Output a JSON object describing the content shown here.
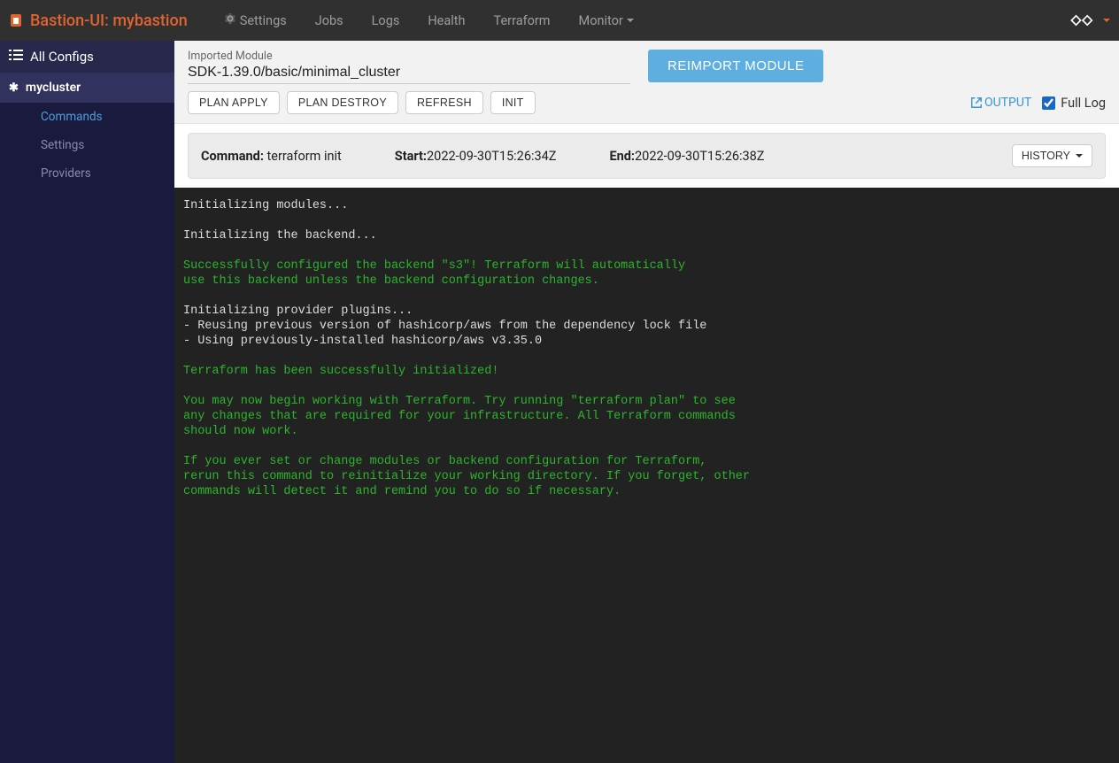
{
  "brand": "Bastion-UI: mybastion",
  "nav": {
    "settings": "Settings",
    "jobs": "Jobs",
    "logs": "Logs",
    "health": "Health",
    "terraform": "Terraform",
    "monitor": "Monitor"
  },
  "sidebar": {
    "all_configs": "All Configs",
    "cluster": "mycluster",
    "children": {
      "commands": "Commands",
      "settings": "Settings",
      "providers": "Providers"
    }
  },
  "toolbar": {
    "imported_module_label": "Imported Module",
    "module_path": "SDK-1.39.0/basic/minimal_cluster",
    "reimport": "REIMPORT MODULE",
    "plan_apply": "PLAN APPLY",
    "plan_destroy": "PLAN DESTROY",
    "refresh": "REFRESH",
    "init": "INIT",
    "output": "OUTPUT",
    "full_log": "Full Log"
  },
  "command_bar": {
    "command_label": "Command:",
    "command_value": "terraform init",
    "start_label": "Start:",
    "start_value": "2022-09-30T15:26:34Z",
    "end_label": "End:",
    "end_value": "2022-09-30T15:26:38Z",
    "history": "HISTORY"
  },
  "terminal": {
    "lines": [
      {
        "cls": "t-white",
        "text": "Initializing modules..."
      },
      {
        "cls": "t-white",
        "text": ""
      },
      {
        "cls": "t-white",
        "text": "Initializing the backend..."
      },
      {
        "cls": "t-white",
        "text": ""
      },
      {
        "cls": "t-green",
        "text": "Successfully configured the backend \"s3\"! Terraform will automatically"
      },
      {
        "cls": "t-green",
        "text": "use this backend unless the backend configuration changes."
      },
      {
        "cls": "t-white",
        "text": ""
      },
      {
        "cls": "t-white",
        "text": "Initializing provider plugins..."
      },
      {
        "cls": "t-white",
        "text": "- Reusing previous version of hashicorp/aws from the dependency lock file"
      },
      {
        "cls": "t-white",
        "text": "- Using previously-installed hashicorp/aws v3.35.0"
      },
      {
        "cls": "t-white",
        "text": ""
      },
      {
        "cls": "t-green",
        "text": "Terraform has been successfully initialized!"
      },
      {
        "cls": "t-white",
        "text": ""
      },
      {
        "cls": "t-green",
        "text": "You may now begin working with Terraform. Try running \"terraform plan\" to see"
      },
      {
        "cls": "t-green",
        "text": "any changes that are required for your infrastructure. All Terraform commands"
      },
      {
        "cls": "t-green",
        "text": "should now work."
      },
      {
        "cls": "t-white",
        "text": ""
      },
      {
        "cls": "t-green",
        "text": "If you ever set or change modules or backend configuration for Terraform,"
      },
      {
        "cls": "t-green",
        "text": "rerun this command to reinitialize your working directory. If you forget, other"
      },
      {
        "cls": "t-green",
        "text": "commands will detect it and remind you to do so if necessary."
      }
    ]
  }
}
